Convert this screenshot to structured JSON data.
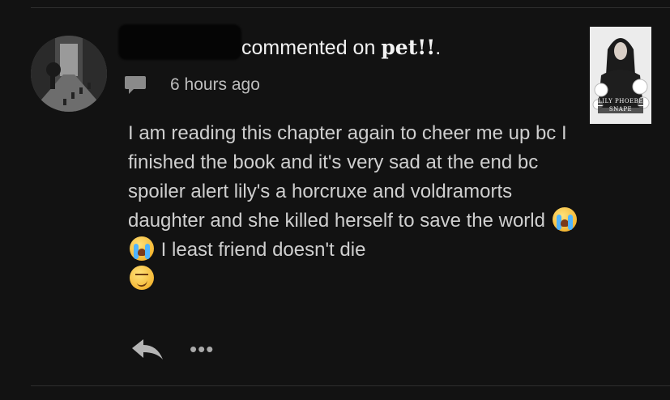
{
  "comment": {
    "action_text": "commented on",
    "story_title": "pet!!",
    "trailing_punct": ".",
    "timestamp": "6 hours ago",
    "body_text": "I am reading this chapter again to cheer me up bc I finished the book and it's very sad at the end bc spoiler alert lily's a horcruxe and voldramorts daughter and she killed herself to save the world",
    "body_text_after_emoji": "I least friend doesn't die",
    "emojis": [
      "loudly-crying-face",
      "loudly-crying-face",
      "smirking-face"
    ]
  },
  "cover": {
    "title_line1": "LILY PHOEBE",
    "title_line2": "SNAPE"
  },
  "actions": {
    "reply_icon": "reply-arrow-icon",
    "more_icon": "more-options-icon",
    "more_label": "•••"
  },
  "colors": {
    "background": "#121212",
    "text_primary": "#f2f2f2",
    "text_body": "#cfcfcf",
    "text_secondary": "#bdbdbd"
  }
}
